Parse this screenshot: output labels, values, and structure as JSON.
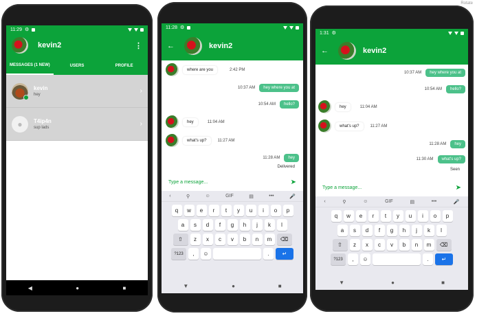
{
  "overlay": {
    "rotate_label": "Rotate"
  },
  "screen1": {
    "status": {
      "time": "11:29"
    },
    "app_title": "kevin2",
    "tabs": [
      {
        "label": "MESSAGES (1 NEW)"
      },
      {
        "label": "USERS"
      },
      {
        "label": "PROFILE"
      }
    ],
    "conversations": [
      {
        "name": "kevin",
        "last_message": "hey"
      },
      {
        "name": "T4ip4n",
        "last_message": "sup lads"
      }
    ]
  },
  "screen2": {
    "status": {
      "time": "11:28"
    },
    "chat_title": "kevin2",
    "messages": [
      {
        "dir": "in",
        "text": "where are you",
        "time": "2:42 PM"
      },
      {
        "dir": "out",
        "text": "hey where you at",
        "time": "10:37 AM"
      },
      {
        "dir": "out",
        "text": "hello?",
        "time": "10:54 AM"
      },
      {
        "dir": "in",
        "text": "hey",
        "time": "11:04 AM"
      },
      {
        "dir": "in",
        "text": "what's up?",
        "time": "11:27 AM"
      },
      {
        "dir": "out",
        "text": "hey",
        "time": "11:28 AM"
      }
    ],
    "delivery_status": "Delivered",
    "input_placeholder": "Type a message..."
  },
  "screen3": {
    "status": {
      "time": "1:31"
    },
    "chat_title": "kevin2",
    "messages": [
      {
        "dir": "out",
        "text": "hey where you at",
        "time": "10:37 AM"
      },
      {
        "dir": "out",
        "text": "hello?",
        "time": "10:54 AM"
      },
      {
        "dir": "in",
        "text": "hey",
        "time": "11:04 AM"
      },
      {
        "dir": "in",
        "text": "what's up?",
        "time": "11:27 AM"
      },
      {
        "dir": "out",
        "text": "hey",
        "time": "11:28 AM"
      },
      {
        "dir": "out",
        "text": "what's up?",
        "time": "11:30 AM"
      }
    ],
    "delivery_status": "Seen",
    "input_placeholder": "Type a message..."
  },
  "keyboard": {
    "toolbar": [
      "‹",
      "⚲",
      "☺",
      "GIF",
      "▤",
      "•••",
      "🎤"
    ],
    "row1": [
      "q",
      "w",
      "e",
      "r",
      "t",
      "y",
      "u",
      "i",
      "o",
      "p"
    ],
    "row2": [
      "a",
      "s",
      "d",
      "f",
      "g",
      "h",
      "j",
      "k",
      "l"
    ],
    "row3": [
      "z",
      "x",
      "c",
      "v",
      "b",
      "n",
      "m"
    ],
    "symbols_label": "?123",
    "comma": ",",
    "period": "."
  },
  "colors": {
    "brand_green": "#0ca33a",
    "bubble_green": "#4cc18a",
    "enter_blue": "#1a73e8"
  }
}
